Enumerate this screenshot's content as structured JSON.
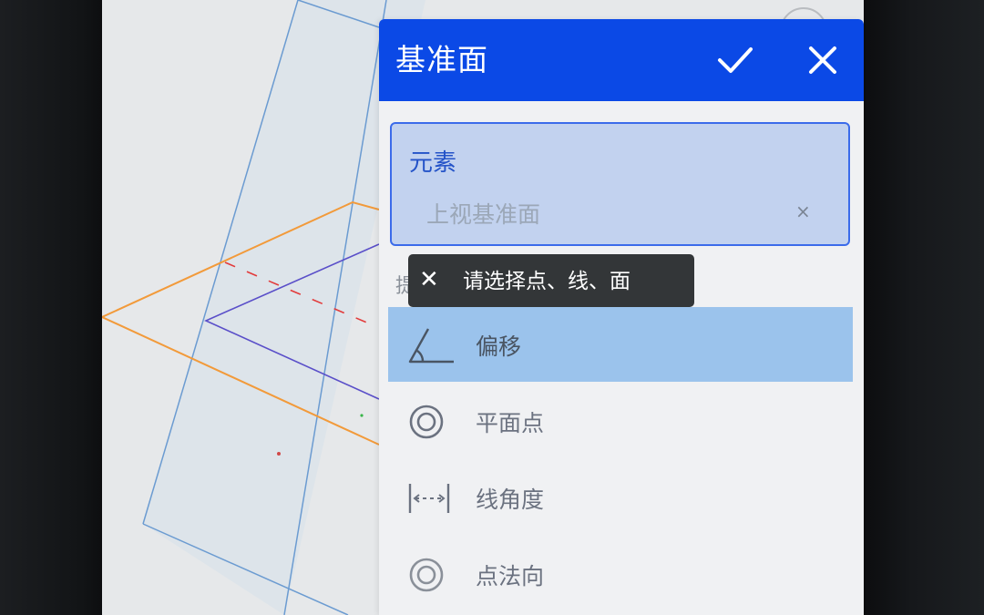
{
  "panel": {
    "title": "基准面",
    "confirm_icon": "checkmark-icon",
    "close_icon": "close-icon",
    "header_color": "#0b49e6"
  },
  "element_field": {
    "label": "元素",
    "value": "上视基准面",
    "clear_symbol": "×"
  },
  "hidden_label": "提",
  "toast": {
    "close_symbol": "✕",
    "message": "请选择点、线、面"
  },
  "options": [
    {
      "label": "偏移",
      "icon": "angle-offset-icon",
      "selected": true
    },
    {
      "label": "平面点",
      "icon": "concentric-circle-icon",
      "selected": false
    },
    {
      "label": "线角度",
      "icon": "dimension-line-icon",
      "selected": false
    },
    {
      "label": "点法向",
      "icon": "concentric-circle-icon",
      "selected": false
    }
  ],
  "colors": {
    "selected_row": "#9bc3ec",
    "accent": "#3b6bea",
    "plane_outline": "#f29a3a",
    "sketch_line": "#5a4fc9"
  }
}
